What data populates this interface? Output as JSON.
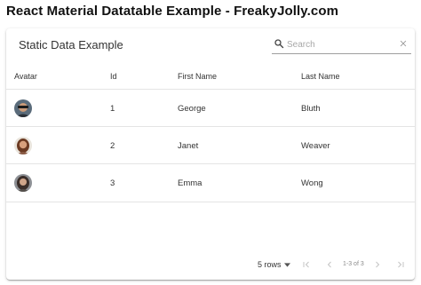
{
  "page": {
    "title": "React Material Datatable Example - FreakyJolly.com"
  },
  "table": {
    "title": "Static Data Example",
    "search": {
      "value": "",
      "placeholder": "Search"
    },
    "columns": [
      "Avatar",
      "Id",
      "First Name",
      "Last Name"
    ],
    "rows": [
      {
        "avatar": "avatar-person-1",
        "id": "1",
        "first_name": "George",
        "last_name": "Bluth"
      },
      {
        "avatar": "avatar-person-2",
        "id": "2",
        "first_name": "Janet",
        "last_name": "Weaver"
      },
      {
        "avatar": "avatar-person-3",
        "id": "3",
        "first_name": "Emma",
        "last_name": "Wong"
      }
    ],
    "pagination": {
      "rows_per_page": "5 rows",
      "status": "1-3 of 3"
    }
  },
  "icons": {
    "search": "search-icon",
    "clear": "close-icon",
    "first": "first-page-icon",
    "prev": "chevron-left-icon",
    "next": "chevron-right-icon",
    "last": "last-page-icon",
    "rows_dropdown": "caret-down-icon"
  },
  "colors": {
    "icon_disabled": "#c4c4c4",
    "divider": "#e4e4e4"
  }
}
